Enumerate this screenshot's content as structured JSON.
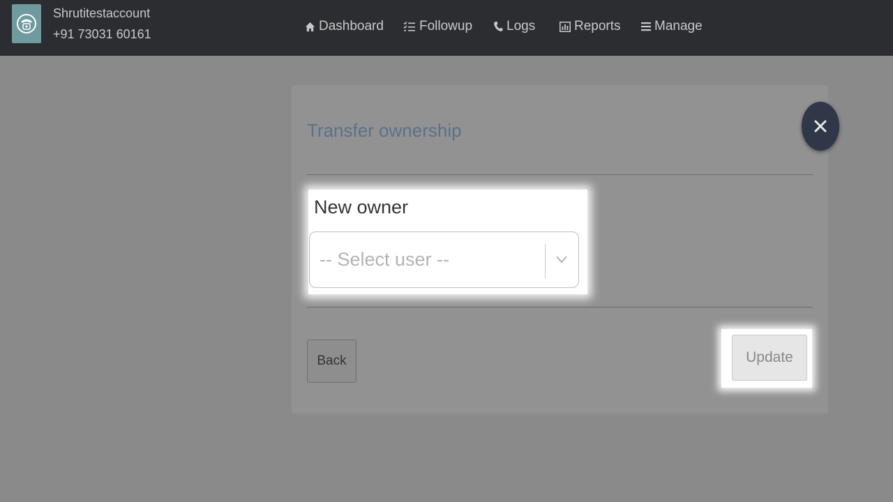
{
  "header": {
    "account_name": "Shrutitestaccount",
    "account_phone": "+91 73031 60161",
    "logo_icon": "telephone-icon",
    "nav": [
      {
        "label": "Dashboard",
        "icon": "home-icon"
      },
      {
        "label": "Followup",
        "icon": "checklist-icon"
      },
      {
        "label": "Logs",
        "icon": "phone-icon"
      },
      {
        "label": "Reports",
        "icon": "bar-chart-icon"
      },
      {
        "label": "Manage",
        "icon": "menu-icon"
      }
    ]
  },
  "modal": {
    "title": "Transfer ownership",
    "close_icon": "close-icon",
    "field_label": "New owner",
    "select_placeholder": "-- Select user --",
    "back_label": "Back",
    "update_label": "Update"
  },
  "colors": {
    "topbar": "#2b2d30",
    "title": "#5a7288",
    "close_button": "#2f3748",
    "overlay": "#8a8a8a"
  }
}
